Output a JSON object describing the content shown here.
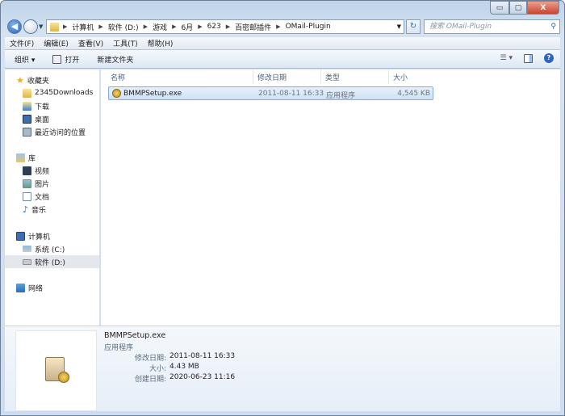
{
  "window": {
    "controls": {
      "minimize": "▭",
      "maximize": "▢",
      "close": "X"
    }
  },
  "address": {
    "crumbs": [
      "计算机",
      "软件 (D:)",
      "游戏",
      "6月",
      "623",
      "百密邮插件",
      "OMail-Plugin"
    ]
  },
  "search": {
    "placeholder": "搜索 OMail-Plugin"
  },
  "menu": [
    "文件(F)",
    "编辑(E)",
    "查看(V)",
    "工具(T)",
    "帮助(H)"
  ],
  "toolbar": {
    "organize": "组织 ▾",
    "open": "打开",
    "new_folder": "新建文件夹"
  },
  "sidebar": {
    "favorites": {
      "label": "收藏夹",
      "items": [
        "2345Downloads",
        "下载",
        "桌面",
        "最近访问的位置"
      ]
    },
    "libraries": {
      "label": "库",
      "items": [
        "视频",
        "图片",
        "文档",
        "音乐"
      ]
    },
    "computer": {
      "label": "计算机",
      "items": [
        "系统 (C:)",
        "软件 (D:)"
      ]
    },
    "network": {
      "label": "网络"
    }
  },
  "columns": [
    "名称",
    "修改日期",
    "类型",
    "大小"
  ],
  "files": [
    {
      "name": "BMMPSetup.exe",
      "modified": "2011-08-11 16:33",
      "type": "应用程序",
      "size": "4,545 KB"
    }
  ],
  "details": {
    "name": "BMMPSetup.exe",
    "type": "应用程序",
    "modified_label": "修改日期:",
    "modified": "2011-08-11 16:33",
    "size_label": "大小:",
    "size": "4.43 MB",
    "created_label": "创建日期:",
    "created": "2020-06-23 11:16"
  }
}
